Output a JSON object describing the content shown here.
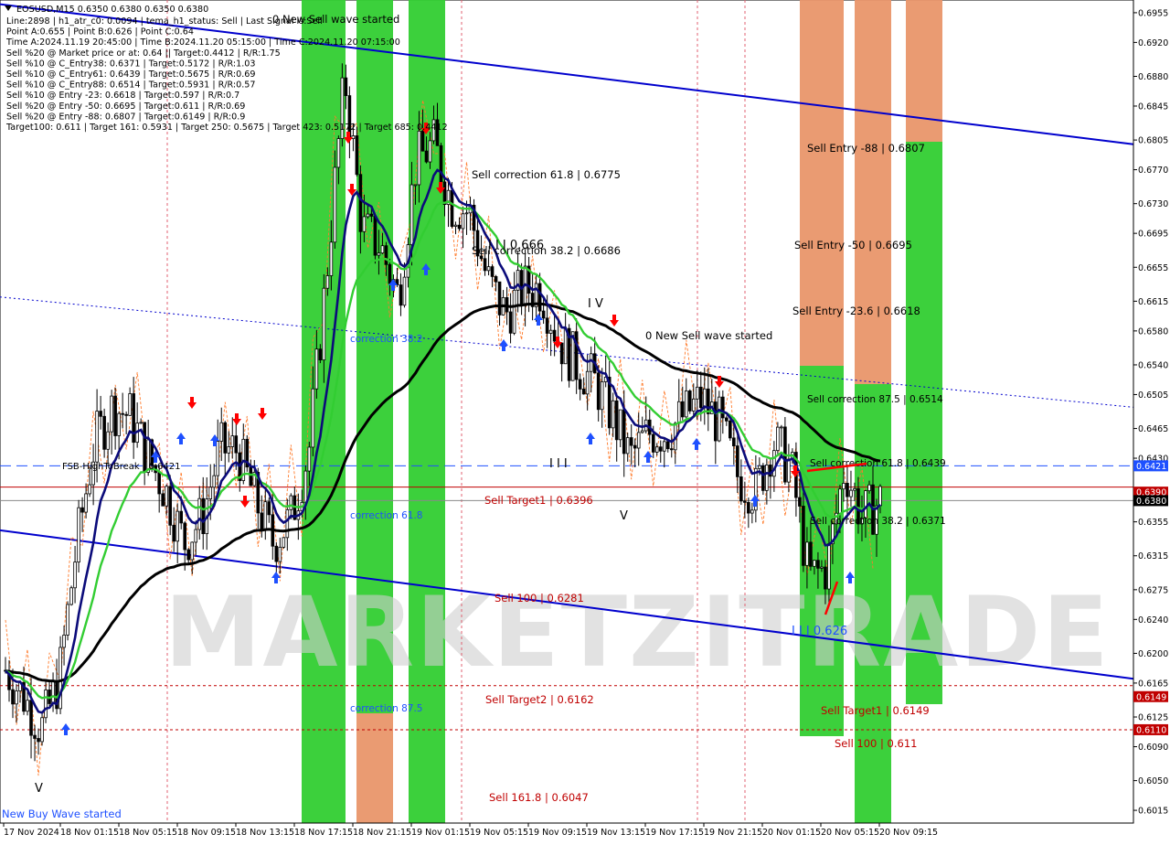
{
  "header": {
    "title": "EOSUSD,M15  0.6350 0.6380 0.6350 0.6380",
    "info_lines": [
      "Line:2898 | h1_atr_c0: 0.0094 | tema_h1_status: Sell | Last Signal is:Sell",
      "Point A:0.655 | Point B:0.626 | Point C:0.64",
      "Time A:2024.11.19 20:45:00 | Time B:2024.11.20 05:15:00 | Time C:2024.11.20 07:15:00",
      "Sell %20 @ Market price or at: 0.64 || Target:0.4412 | R/R:1.75",
      "Sell %10 @ C_Entry38: 0.6371 | Target:0.5172 | R/R:1.03",
      "Sell %10 @ C_Entry61: 0.6439 | Target:0.5675 | R/R:0.69",
      "Sell %10 @ C_Entry88: 0.6514 | Target:0.5931 | R/R:0.57",
      "Sell %10 @ Entry -23: 0.6618 | Target:0.597 | R/R:0.7",
      "Sell %20 @ Entry -50: 0.6695 | Target:0.611 | R/R:0.69",
      "Sell %20 @ Entry -88: 0.6807 | Target:0.6149 | R/R:0.9",
      "Target100: 0.611 | Target 161: 0.5931 | Target 250: 0.5675 | Target 423: 0.5172 | Target 685: 0.4412"
    ]
  },
  "watermark": "MARKETZITRADE",
  "colors": {
    "up_candle": "#000000",
    "down_candle": "#000000",
    "green_zone": "#32cd32",
    "orange_zone": "#e9966a",
    "channel": "#0000cd",
    "ma_black": "#000000",
    "ma_green": "#32cd32",
    "ma_navy": "#0b0b7a",
    "sell_label": "#c00000",
    "buy_arrow": "#1e50ff",
    "sell_arrow": "#ff0000"
  },
  "price_axis": {
    "ticks": [
      "0.6955",
      "0.6920",
      "0.6880",
      "0.6845",
      "0.6805",
      "0.6770",
      "0.6730",
      "0.6695",
      "0.6655",
      "0.6615",
      "0.6580",
      "0.6540",
      "0.6505",
      "0.6465",
      "0.6430",
      "0.6390",
      "0.6355",
      "0.6315",
      "0.6275",
      "0.6240",
      "0.6200",
      "0.6165",
      "0.6125",
      "0.6090",
      "0.6050",
      "0.6015"
    ],
    "tags": [
      {
        "value": "0.6421",
        "color": "#1e50ff"
      },
      {
        "value": "0.6390",
        "color": "#c00000"
      },
      {
        "value": "0.6380",
        "color": "#000000"
      },
      {
        "value": "0.6149",
        "color": "#c00000"
      },
      {
        "value": "0.6110",
        "color": "#c00000"
      }
    ]
  },
  "time_axis": {
    "labels": [
      "17 Nov 2024",
      "18 Nov 01:15",
      "18 Nov 05:15",
      "18 Nov 09:15",
      "18 Nov 13:15",
      "18 Nov 17:15",
      "18 Nov 21:15",
      "19 Nov 01:15",
      "19 Nov 05:15",
      "19 Nov 09:15",
      "19 Nov 13:15",
      "19 Nov 17:15",
      "19 Nov 21:15",
      "20 Nov 01:15",
      "20 Nov 05:15",
      "20 Nov 09:15"
    ]
  },
  "annotations": {
    "new_sell_wave_top": "0 New Sell wave started",
    "new_sell_wave_mid": "0 New Sell wave started",
    "new_buy_wave": "New Buy Wave started",
    "fsb_high": "FSB-HighToBreak | 0.6421",
    "sell_correction_618": "Sell correction 61.8 | 0.6775",
    "sell_correction_382_top": "Sell correction 38.2 | 0.6686",
    "sell_correction_875": "Sell correction 87.5 | 0.6514",
    "sell_correction_618_low": "Sell correction 61.8 | 0.6439",
    "sell_correction_382_low": "Sell correction 38.2 | 0.6371",
    "sell_entry_88": "Sell Entry -88 | 0.6807",
    "sell_entry_50": "Sell Entry -50 | 0.6695",
    "sell_entry_236": "Sell Entry -23.6 | 0.6618",
    "sell_target1_left": "Sell Target1 | 0.6396",
    "sell_100_left": "Sell 100 | 0.6281",
    "sell_target2_left": "Sell Target2 | 0.6162",
    "sell_1618_left": "Sell 161.8 | 0.6047",
    "sell_target1_right": "Sell Target1 | 0.6149",
    "sell_100_right": "Sell 100 | 0.611",
    "correction_382": "correction 38.2",
    "correction_618": "correction 61.8",
    "correction_875": "correction 87.5",
    "wave_iii_0666": "I I I 0.666",
    "wave_iv": "I V",
    "wave_iii": "I I I",
    "wave_v_mid": "V",
    "wave_v_left": "V",
    "wave_iii_0626": "I I I 0.626"
  },
  "chart_data": {
    "type": "candlestick",
    "symbol": "EOSUSD",
    "timeframe": "M15",
    "ohlc_last": {
      "open": 0.635,
      "high": 0.638,
      "low": 0.635,
      "close": 0.638
    },
    "ylim": [
      0.6,
      0.697
    ],
    "x_labels": [
      "17 Nov 2024",
      "18 Nov 01:15",
      "18 Nov 05:15",
      "18 Nov 09:15",
      "18 Nov 13:15",
      "18 Nov 17:15",
      "18 Nov 21:15",
      "19 Nov 01:15",
      "19 Nov 05:15",
      "19 Nov 09:15",
      "19 Nov 13:15",
      "19 Nov 17:15",
      "19 Nov 21:15",
      "20 Nov 01:15",
      "20 Nov 05:15",
      "20 Nov 09:15"
    ],
    "price_path": [
      0.618,
      0.615,
      0.611,
      0.617,
      0.633,
      0.645,
      0.649,
      0.648,
      0.643,
      0.639,
      0.633,
      0.636,
      0.644,
      0.644,
      0.638,
      0.633,
      0.636,
      0.644,
      0.665,
      0.688,
      0.67,
      0.668,
      0.662,
      0.678,
      0.68,
      0.673,
      0.672,
      0.664,
      0.66,
      0.663,
      0.663,
      0.657,
      0.654,
      0.652,
      0.648,
      0.643,
      0.646,
      0.646,
      0.648,
      0.65,
      0.647,
      0.641,
      0.639,
      0.645,
      0.642,
      0.629,
      0.63,
      0.642,
      0.636,
      0.638
    ],
    "horizontal_levels": [
      {
        "value": 0.6421,
        "style": "dashed",
        "color": "#1e50ff",
        "label": "FSB-HighToBreak | 0.6421"
      },
      {
        "value": 0.6396,
        "style": "solid",
        "color": "#c00000",
        "label": "Sell Target1 | 0.6396"
      },
      {
        "value": 0.638,
        "style": "solid",
        "color": "#888888",
        "label": ""
      },
      {
        "value": 0.6162,
        "style": "dotted",
        "color": "#c00000",
        "label": "Sell Target2 | 0.6162"
      },
      {
        "value": 0.611,
        "style": "dotted",
        "color": "#c00000",
        "label": "Sell 100 | 0.611"
      }
    ],
    "channel_lines": [
      {
        "name": "upper",
        "from": 0.6965,
        "to": 0.68
      },
      {
        "name": "lower",
        "from": 0.6345,
        "to": 0.617
      },
      {
        "name": "mid-dotted",
        "from": 0.662,
        "to": 0.649
      }
    ],
    "grid": false
  }
}
